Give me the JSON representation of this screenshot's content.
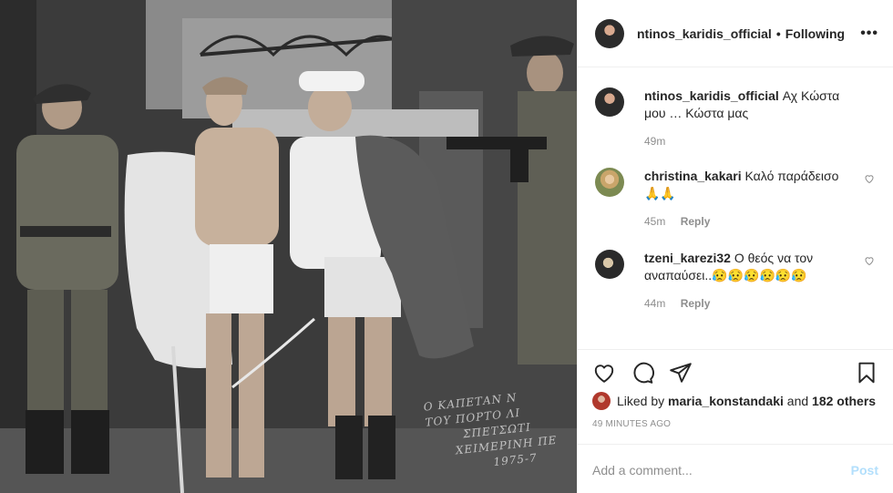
{
  "post": {
    "username": "ntinos_karidis_official",
    "separator": "•",
    "follow_status": "Following",
    "more_label": "•••"
  },
  "photo": {
    "handwriting": [
      "Ο ΚΑΠΕΤΑΝ Ν",
      "ΤΟΥ ΠΟΡΤΟ ΛΙ",
      "ΣΠΕΤΣΩΤΙ",
      "ΧΕΙΜΕΡΙΝΗ ΠΕ",
      "1975-7"
    ]
  },
  "comments": [
    {
      "username": "ntinos_karidis_official",
      "text": "Αχ Κώστα μου … Κώστα μας",
      "time": "49m",
      "reply": ""
    },
    {
      "username": "christina_kakari",
      "text": "Καλό παράδεισο 🙏🙏",
      "time": "45m",
      "reply": "Reply"
    },
    {
      "username": "tzeni_karezi32",
      "text": "Ο θεός να τον αναπαύσει..😥😥😥😥😥😥",
      "time": "44m",
      "reply": "Reply"
    }
  ],
  "actions": {
    "icons": [
      "heart-icon",
      "comment-icon",
      "share-icon",
      "bookmark-icon"
    ]
  },
  "likes": {
    "prefix": "Liked by",
    "user": "maria_konstandaki",
    "middle": "and",
    "others": "182 others"
  },
  "timestamp": "49 MINUTES AGO",
  "composer": {
    "placeholder": "Add a comment...",
    "post_label": "Post"
  },
  "colors": {
    "post_button_disabled": "#b2dffc",
    "muted_text": "#8e8e8e",
    "divider": "#efefef"
  }
}
